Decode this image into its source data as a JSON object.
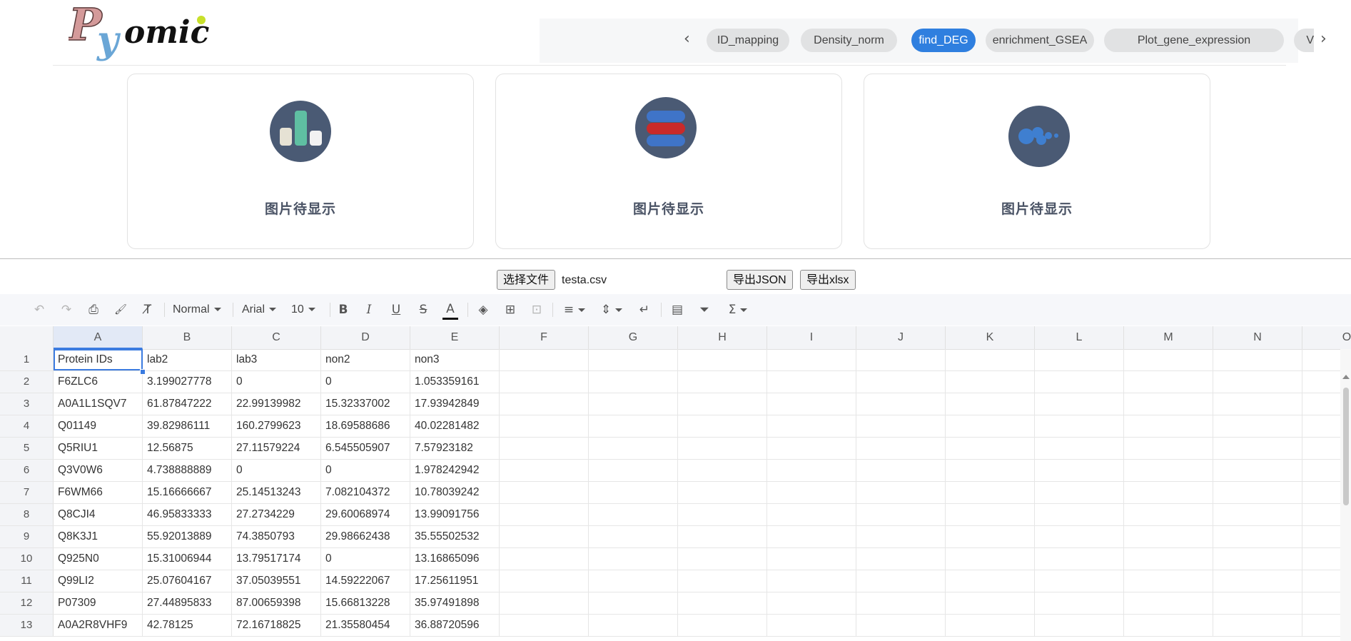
{
  "header": {
    "logo_text": "Pyomic",
    "tabs": [
      {
        "label": "ID_mapping",
        "active": false
      },
      {
        "label": "Density_norm",
        "active": false
      },
      {
        "label": "find_DEG",
        "active": true
      },
      {
        "label": "enrichment_GSEA",
        "active": false
      },
      {
        "label": "Plot_gene_expression",
        "active": false
      },
      {
        "label": "V",
        "active": false
      }
    ],
    "prev_icon": "‹",
    "next_icon": "›"
  },
  "cards": [
    {
      "icon": "bar-chart-icon",
      "caption": "图片待显示"
    },
    {
      "icon": "stacked-bars-icon",
      "caption": "图片待显示"
    },
    {
      "icon": "bubble-icon",
      "caption": "图片待显示"
    }
  ],
  "file_bar": {
    "choose_file_label": "选择文件",
    "file_name": "testa.csv",
    "export_json_label": "导出JSON",
    "export_xlsx_label": "导出xlsx"
  },
  "toolbar": {
    "style": "Normal",
    "font": "Arial",
    "size": "10",
    "icons": {
      "undo": "↶",
      "redo": "↷",
      "print": "⎙",
      "format_painter": "🖌",
      "clear_format": "T̸",
      "bold": "B",
      "italic": "I",
      "underline": "U",
      "strike": "S",
      "text_color": "A",
      "fill": "◈",
      "borders": "⊞",
      "merge": "⊡",
      "align": "≡",
      "valign": "⇕",
      "wrap": "↵",
      "table": "▤",
      "filter": "⏷",
      "sum": "Σ"
    }
  },
  "sheet": {
    "columns": [
      "A",
      "B",
      "C",
      "D",
      "E",
      "F",
      "G",
      "H",
      "I",
      "J",
      "K",
      "L",
      "M",
      "N",
      "O"
    ],
    "selected_column": "A",
    "selected_cell": "A1",
    "rows": [
      {
        "n": "1",
        "cells": [
          "Protein IDs",
          "lab2",
          "lab3",
          "non2",
          "non3"
        ]
      },
      {
        "n": "2",
        "cells": [
          "F6ZLC6",
          "3.199027778",
          "0",
          "0",
          "1.053359161"
        ]
      },
      {
        "n": "3",
        "cells": [
          "A0A1L1SQV7",
          "61.87847222",
          "22.99139982",
          "15.32337002",
          "17.93942849"
        ]
      },
      {
        "n": "4",
        "cells": [
          "Q01149",
          "39.82986111",
          "160.2799623",
          "18.69588686",
          "40.02281482"
        ]
      },
      {
        "n": "5",
        "cells": [
          "Q5RIU1",
          "12.56875",
          "27.11579224",
          "6.545505907",
          "7.57923182"
        ]
      },
      {
        "n": "6",
        "cells": [
          "Q3V0W6",
          "4.738888889",
          "0",
          "0",
          "1.978242942"
        ]
      },
      {
        "n": "7",
        "cells": [
          "F6WM66",
          "15.16666667",
          "25.14513243",
          "7.082104372",
          "10.78039242"
        ]
      },
      {
        "n": "8",
        "cells": [
          "Q8CJI4",
          "46.95833333",
          "27.2734229",
          "29.60068974",
          "13.99091756"
        ]
      },
      {
        "n": "9",
        "cells": [
          "Q8K3J1",
          "55.92013889",
          "74.3850793",
          "29.98662438",
          "35.55502532"
        ]
      },
      {
        "n": "10",
        "cells": [
          "Q925N0",
          "15.31006944",
          "13.79517174",
          "0",
          "13.16865096"
        ]
      },
      {
        "n": "11",
        "cells": [
          "Q99LI2",
          "25.07604167",
          "37.05039551",
          "14.59222067",
          "17.25611951"
        ]
      },
      {
        "n": "12",
        "cells": [
          "P07309",
          "27.44895833",
          "87.00659398",
          "15.66813228",
          "35.97491898"
        ]
      },
      {
        "n": "13",
        "cells": [
          "A0A2R8VHF9",
          "42.78125",
          "72.16718825",
          "21.35580454",
          "36.88720596"
        ]
      }
    ]
  }
}
